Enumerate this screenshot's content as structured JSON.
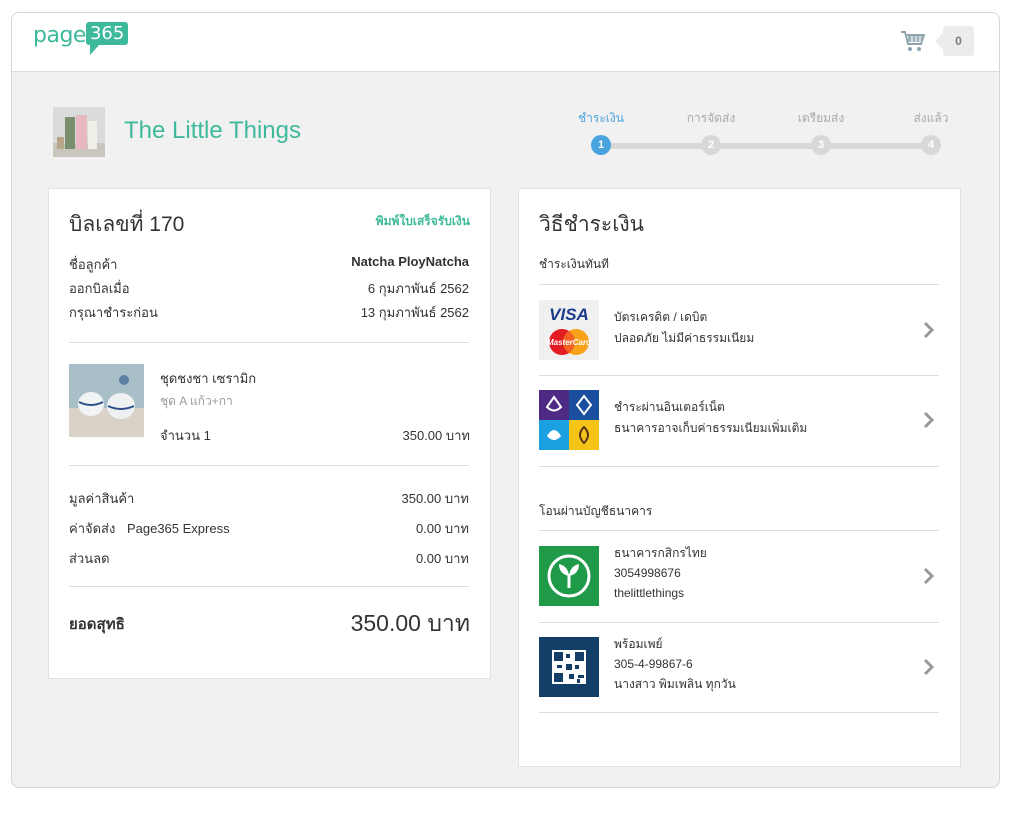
{
  "header": {
    "logo_text": "page",
    "logo_number": "365",
    "cart_count": "0",
    "cart_icon": "cart-icon"
  },
  "shop": {
    "name": "The Little Things"
  },
  "steps": [
    {
      "label": "ชำระเงิน",
      "number": "1",
      "active": true
    },
    {
      "label": "การจัดส่ง",
      "number": "2",
      "active": false
    },
    {
      "label": "เตรียมส่ง",
      "number": "3",
      "active": false
    },
    {
      "label": "ส่งแล้ว",
      "number": "4",
      "active": false
    }
  ],
  "bill": {
    "title": "บิลเลขที่ 170",
    "print_link": "พิมพ์ใบเสร็จรับเงิน",
    "customer_label": "ชื่อลูกค้า",
    "customer_value": "Natcha PloyNatcha",
    "issued_label": "ออกบิลเมื่อ",
    "issued_value": "6 กุมภาพันธ์ 2562",
    "due_label": "กรุณาชำระก่อน",
    "due_value": "13 กุมภาพันธ์ 2562",
    "item": {
      "name": "ชุดชงชา เซรามิก",
      "variant": "ชุด A แก้ว+กา",
      "qty": "จำนวน 1",
      "price": "350.00 บาท"
    },
    "subtotal_label": "มูลค่าสินค้า",
    "subtotal_value": "350.00 บาท",
    "shipping_label": "ค่าจัดส่ง",
    "shipping_method": "Page365 Express",
    "shipping_value": "0.00 บาท",
    "discount_label": "ส่วนลด",
    "discount_value": "0.00 บาท",
    "net_label": "ยอดสุทธิ",
    "net_value": "350.00 บาท"
  },
  "payment": {
    "title": "วิธีชำระเงิน",
    "instant_heading": "ชำระเงินทันที",
    "methods": [
      {
        "line1": "บัตรเครดิต / เดบิต",
        "line2": "ปลอดภัย ไม่มีค่าธรรมเนียม",
        "icon": "visa-mastercard-icon",
        "visa": "VISA",
        "mastercard": "MasterCard"
      },
      {
        "line1": "ชำระผ่านอินเตอร์เน็ต",
        "line2": "ธนาคารอาจเก็บค่าธรรมเนียมเพิ่มเติม",
        "icon": "internet-banking-icon"
      }
    ],
    "transfer_heading": "โอนผ่านบัญชีธนาคาร",
    "banks": [
      {
        "line1": "ธนาคารกสิกรไทย",
        "line2": "3054998676",
        "line3": "thelittlethings",
        "icon": "kasikorn-bank-icon"
      },
      {
        "line1": "พร้อมเพย์",
        "line2": "305-4-99867-6",
        "line3": "นางสาว พิมเพลิน ทุกวัน",
        "icon": "promptpay-qr-icon"
      }
    ]
  },
  "colors": {
    "brand": "#3fb99b",
    "step_active": "#4aa3df",
    "kasikorn": "#1f9a48",
    "promptpay": "#123e67"
  }
}
